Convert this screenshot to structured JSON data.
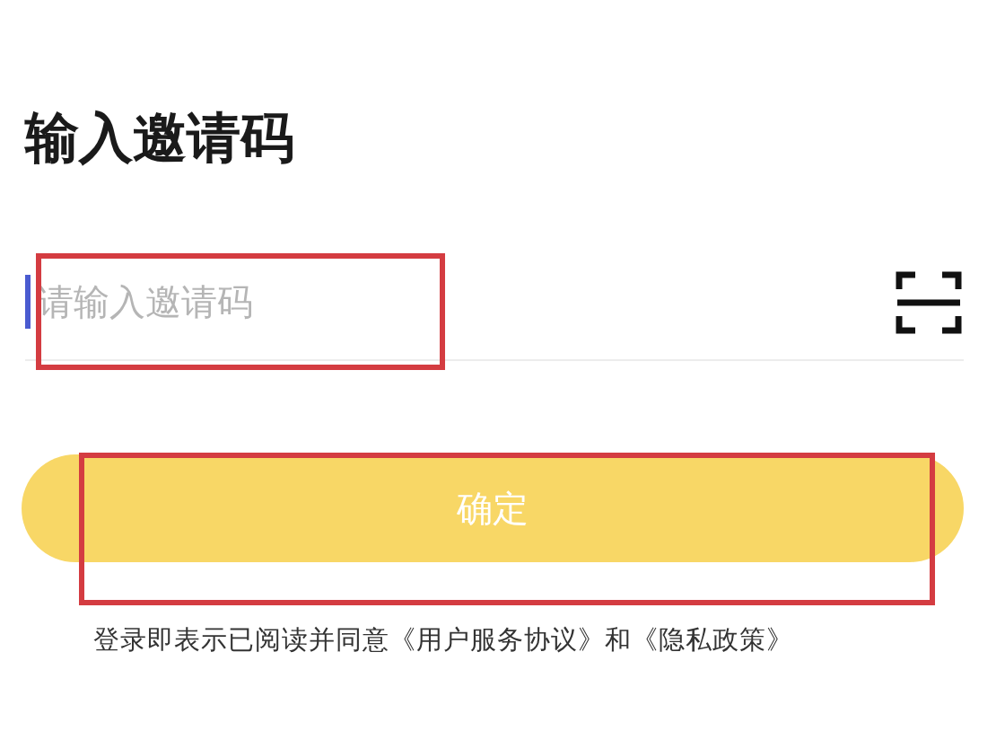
{
  "title": "输入邀请码",
  "invite_field": {
    "placeholder": "请输入邀请码"
  },
  "confirm_button": {
    "label": "确定"
  },
  "agreement": "登录即表示已阅读并同意《用户服务协议》和《隐私政策》"
}
